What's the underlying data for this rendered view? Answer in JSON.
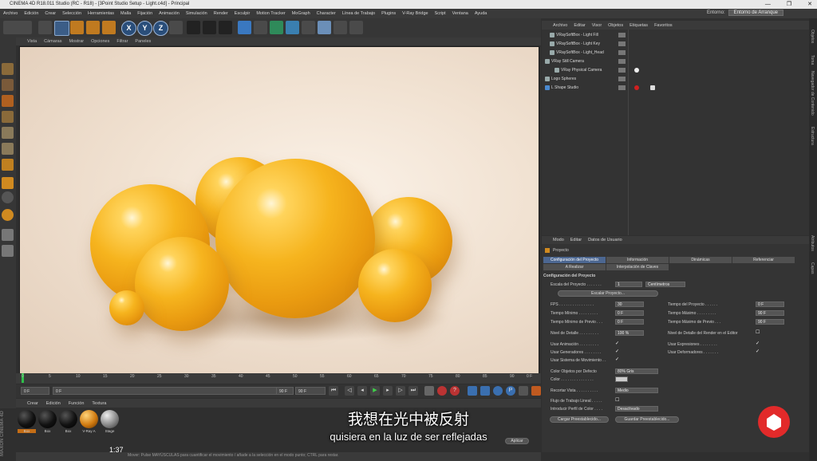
{
  "window": {
    "title": "CINEMA 4D R18.011 Studio (RC - R18) - [3Point Studio Setup - Light.c4d] - Principal",
    "controls": [
      "—",
      "❐",
      "✕"
    ]
  },
  "menu": [
    "Archivo",
    "Edición",
    "Crear",
    "Selección",
    "Herramientas",
    "Malla",
    "Fijación",
    "Animación",
    "Simulación",
    "Render",
    "Esculpir",
    "Motion Tracker",
    "MoGraph",
    "Character",
    "Línea de Trabajo",
    "Plugins",
    "V-Ray Bridge",
    "Script",
    "Ventana",
    "Ayuda"
  ],
  "environment": {
    "label": "Entorno:",
    "value": "Entorno de Arranque"
  },
  "toolbar": {
    "axes": [
      "X",
      "Y",
      "Z"
    ]
  },
  "viewport_menu": [
    "Vista",
    "Cámaras",
    "Mostrar",
    "Opciones",
    "Filtrar",
    "Paneles"
  ],
  "timeline": {
    "ticks": [
      "0",
      "5",
      "10",
      "15",
      "20",
      "25",
      "30",
      "35",
      "40",
      "45",
      "50",
      "55",
      "60",
      "65",
      "70",
      "75",
      "80",
      "85",
      "90"
    ],
    "end_frame": "0 F"
  },
  "playbar": {
    "start": "0 F",
    "current": "0 F",
    "range_end": "90 F",
    "end": "90 F"
  },
  "material_menu": [
    "Crear",
    "Edición",
    "Función",
    "Textura"
  ],
  "materials": [
    {
      "label": "Box",
      "color": "#111111",
      "selected": true
    },
    {
      "label": "Box",
      "color": "#111111"
    },
    {
      "label": "Box",
      "color": "#111111"
    },
    {
      "label": "V-Ray A",
      "color": "#d07a10"
    },
    {
      "label": "Stage",
      "color": "#888888"
    }
  ],
  "brand": "MAXON CINEMA 4D",
  "status": {
    "text": "Mover: Pulse MAYÚSCULAS para cuantificar el movimiento / añade a la selección en el modo punto; CTRL para restar.",
    "time": "1:37"
  },
  "object_manager": {
    "menu": [
      "Archivo",
      "Editar",
      "Visor",
      "Objetos",
      "Etiquetas",
      "Favoritos"
    ],
    "objects": [
      {
        "name": "VRaySoftBox - Light Fill",
        "indent": 1
      },
      {
        "name": "VRaySoftBox - Light Key",
        "indent": 1
      },
      {
        "name": "VRaySoftBox - Light_Head",
        "indent": 1
      },
      {
        "name": "VRay Still Camera",
        "indent": 0
      },
      {
        "name": "VRay Physical Camera",
        "indent": 2
      },
      {
        "name": "Logo Spheres",
        "indent": 0
      },
      {
        "name": "L Shape Studio",
        "indent": 0
      }
    ]
  },
  "right_tabs": [
    "Objetos",
    "Toma",
    "Navegador de Contenido",
    "Estructura",
    "Atributos",
    "Capas"
  ],
  "attributes": {
    "menu": [
      "Modo",
      "Editar",
      "Datos de Usuario"
    ],
    "header": "Proyecto",
    "tabs_row1": [
      "Configuración del Proyecto",
      "Información",
      "Dinámicas",
      "Referenciar"
    ],
    "tabs_row2": [
      "A Realizar",
      "Interpolación de Claves"
    ],
    "section": "Configuración del Proyecto",
    "scale_label": "Escala del Proyecto . . . . . . .",
    "scale_value": "1",
    "scale_unit": "Centímetros",
    "scale_button": "Escalar Proyecto...",
    "fps_label": "FPS . . . . . . . . . . . . . . . .",
    "fps_value": "30",
    "min_time_label": "Tiempo Mínimo . . . . . . . . .",
    "min_time_value": "0 F",
    "min_preview_label": "Tiempo Mínimo de Previo . . .",
    "min_preview_value": "0 F",
    "lod_label": "Nivel de Detalle . . . . . . . . .",
    "lod_value": "100 %",
    "project_time_label": "Tiempo del Proyecto . . . . . .",
    "project_time_value": "0 F",
    "max_time_label": "Tiempo Máximo . . . . . . . . .",
    "max_time_value": "90 F",
    "max_preview_label": "Tiempo Máximo de Previo . . .",
    "max_preview_value": "90 F",
    "render_lod_label": "Nivel de Detalle del Render en el Editor",
    "use_anim_label": "Usar Animación . . . . . . . . .",
    "use_gen_label": "Usar Generadores . . . . . . . .",
    "use_motion_label": "Usar Sistema de Movimiento . .",
    "use_expr_label": "Usar Expresiones . . . . . . . .",
    "use_deform_label": "Usar Deformadores . . . . . . .",
    "obj_color_label": "Color Objetos por Defecto",
    "obj_color_value": "80% Gris",
    "color_label": "Color . . . . . . . . . . . . . . .",
    "clip_label": "Recortar Vista . . . . . . . . . .",
    "clip_value": "Medio",
    "linear_label": "Flujo de Trabajo Lineal . . . . .",
    "profile_label": "Introducir Perfil de Color . . . .",
    "profile_value": "Desactivado",
    "load_preset": "Cargar Preestablecido...",
    "save_preset": "Guardar Preestablecido...",
    "apply": "Aplicar"
  },
  "subtitles": {
    "zh": "我想在光中被反射",
    "es": "quisiera en la luz de ser reflejadas"
  },
  "colors": {
    "accent": "#4c6791",
    "sphere": "#f6b41e",
    "logo": "#e22a2a"
  }
}
